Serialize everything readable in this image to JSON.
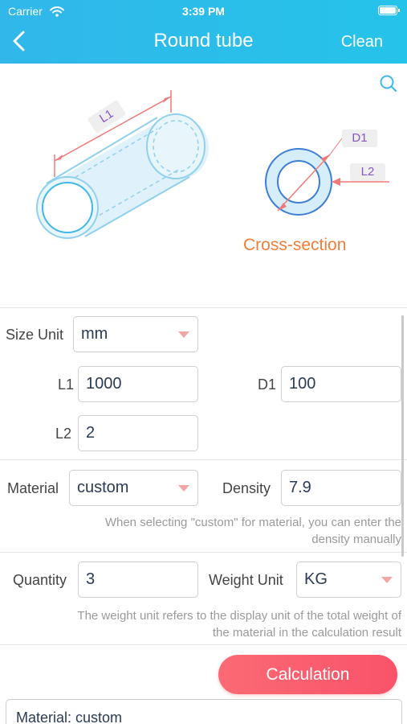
{
  "status_bar": {
    "carrier": "Carrier",
    "time": "3:39 PM"
  },
  "header": {
    "title": "Round tube",
    "clean_label": "Clean"
  },
  "illustration": {
    "l1_tag": "L1",
    "d1_tag": "D1",
    "l2_tag": "L2",
    "cross_section_label": "Cross-section"
  },
  "form": {
    "size_unit": {
      "label": "Size Unit",
      "value": "mm"
    },
    "l1": {
      "label": "L1",
      "value": "1000"
    },
    "d1": {
      "label": "D1",
      "value": "100"
    },
    "l2": {
      "label": "L2",
      "value": "2"
    },
    "material": {
      "label": "Material",
      "value": "custom"
    },
    "density": {
      "label": "Density",
      "value": "7.9"
    },
    "material_hint_line1": "When selecting \"custom\" for material, you can enter the",
    "material_hint_line2": "density manually",
    "quantity": {
      "label": "Quantity",
      "value": "3"
    },
    "weight_unit": {
      "label": "Weight Unit",
      "value": "KG"
    },
    "weight_hint_line1": "The weight unit refers to the display unit of the total weight of",
    "weight_hint_line2": "the material in the calculation result"
  },
  "actions": {
    "calculation_label": "Calculation"
  },
  "result": {
    "text": "Material: custom"
  },
  "colors": {
    "header": "#2dbbe9",
    "accent_orange": "#f07e3a",
    "button_red": "#fa5f6e",
    "tag_purple": "#8a55c9",
    "tube_blue": "#a9dcf2"
  }
}
